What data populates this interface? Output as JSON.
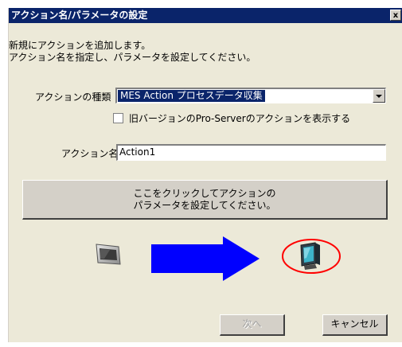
{
  "dialog": {
    "title": "アクション名/パラメータの設定",
    "close_label": "x"
  },
  "description": {
    "line1": "新規にアクションを追加します。",
    "line2": "アクション名を指定し、パラメータを設定してください。"
  },
  "action_type": {
    "label": "アクションの種類",
    "selected_value": "MES Action プロセスデータ収集"
  },
  "legacy_checkbox": {
    "label": "旧バージョンのPro-Serverのアクションを表示する",
    "checked": false
  },
  "action_name": {
    "label": "アクション名",
    "value": "Action1"
  },
  "param_button": {
    "line1": "ここをクリックしてアクションの",
    "line2": "パラメータを設定してください。"
  },
  "icons": {
    "device": "display-device-icon",
    "arrow": "right-arrow-icon",
    "pc": "pc-monitor-icon"
  },
  "colors": {
    "arrow": "#0000ff",
    "highlight_circle": "#ff0000",
    "title_bar": "#0a246a"
  },
  "footer": {
    "next_label": "次へ",
    "cancel_label": "キャンセル"
  }
}
